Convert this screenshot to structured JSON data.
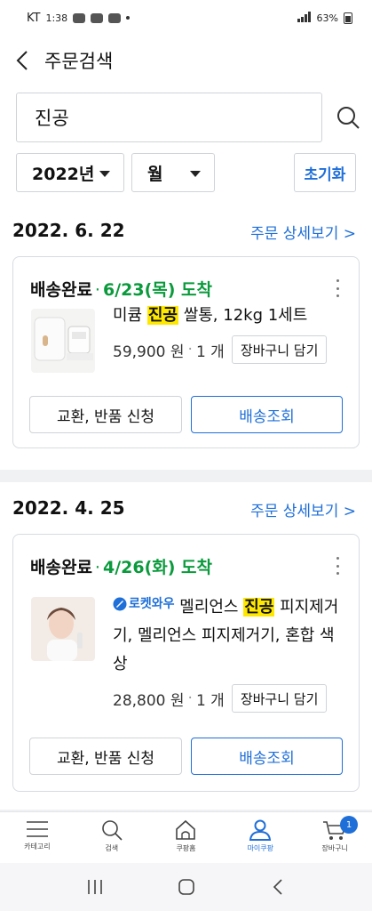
{
  "status_bar": {
    "carrier": "KT",
    "time": "1:38",
    "battery": "63%"
  },
  "header": {
    "title": "주문검색"
  },
  "search": {
    "value": "진공"
  },
  "filters": {
    "year": "2022년",
    "month": "월",
    "reset_label": "초기화"
  },
  "orders": [
    {
      "date": "2022. 6. 22",
      "detail_label": "주문 상세보기 >",
      "status": "배송완료",
      "arrival": "6/23(목) 도착",
      "product": {
        "prefix": "미큠 ",
        "highlight": "진공",
        "suffix": " 쌀통, 12kg 1세트",
        "badge": ""
      },
      "price": "59,900 원",
      "qty": "1 개",
      "cart_label": "장바구니 담기",
      "exchange_label": "교환, 반품 신청",
      "track_label": "배송조회"
    },
    {
      "date": "2022. 4. 25",
      "detail_label": "주문 상세보기 >",
      "status": "배송완료",
      "arrival": "4/26(화) 도착",
      "product": {
        "prefix": " 멜리언스 ",
        "highlight": "진공",
        "suffix": " 피지제거기, 멜리언스 피지제거기, 혼합 색상",
        "badge": "로켓와우"
      },
      "price": "28,800 원",
      "qty": "1 개",
      "cart_label": "장바구니 담기",
      "exchange_label": "교환, 반품 신청",
      "track_label": "배송조회"
    }
  ],
  "tabbar": {
    "items": [
      {
        "label": "카테고리",
        "icon": "menu-icon"
      },
      {
        "label": "검색",
        "icon": "search-icon"
      },
      {
        "label": "쿠팡홈",
        "icon": "home-icon"
      },
      {
        "label": "마이쿠팡",
        "icon": "person-icon",
        "active": true
      },
      {
        "label": "장바구니",
        "icon": "cart-icon",
        "badge": "1"
      }
    ]
  },
  "colors": {
    "accent": "#1f6fd8",
    "arrival": "#0a9a3c",
    "highlight": "#ffe800"
  }
}
